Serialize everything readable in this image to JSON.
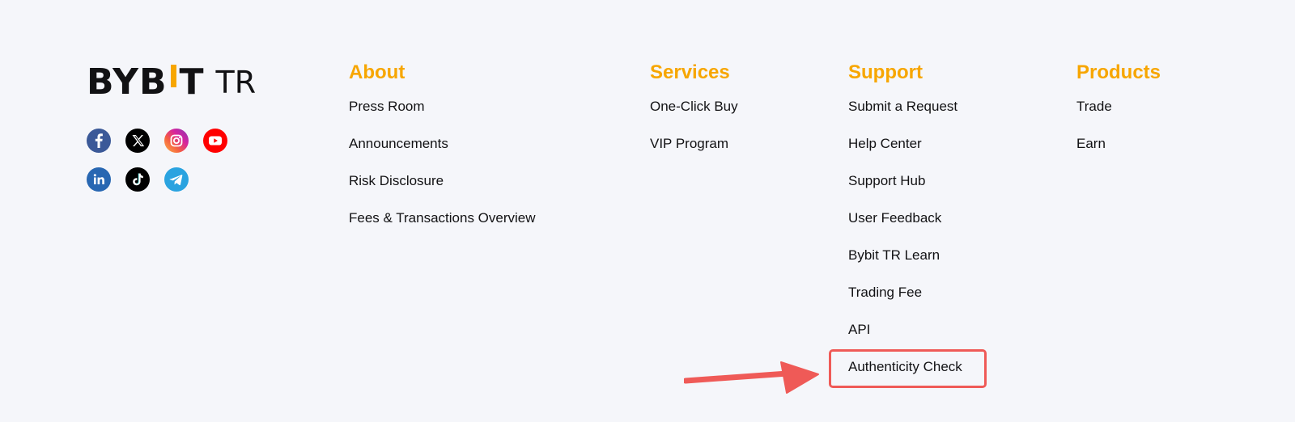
{
  "brand": {
    "logo_left": "BYB",
    "logo_right": "T",
    "logo_suffix": "TR",
    "accent_color": "#f7a600"
  },
  "social": [
    {
      "icon": "facebook-icon",
      "color": "#3b5998"
    },
    {
      "icon": "x-icon",
      "color": "#000000"
    },
    {
      "icon": "instagram-icon",
      "color": "#d6249f"
    },
    {
      "icon": "youtube-icon",
      "color": "#ff0000"
    },
    {
      "icon": "linkedin-icon",
      "color": "#2867b2"
    },
    {
      "icon": "tiktok-icon",
      "color": "#000000"
    },
    {
      "icon": "telegram-icon",
      "color": "#2aa3e0"
    }
  ],
  "columns": {
    "about": {
      "title": "About",
      "links": [
        "Press Room",
        "Announcements",
        "Risk Disclosure",
        "Fees & Transactions Overview"
      ]
    },
    "services": {
      "title": "Services",
      "links": [
        "One-Click Buy",
        "VIP Program"
      ]
    },
    "support": {
      "title": "Support",
      "links": [
        "Submit a Request",
        "Help Center",
        "Support Hub",
        "User Feedback",
        "Bybit TR Learn",
        "Trading Fee",
        "API",
        "Authenticity Check"
      ]
    },
    "products": {
      "title": "Products",
      "links": [
        "Trade",
        "Earn"
      ]
    }
  },
  "annotation": {
    "highlighted_item": "Authenticity Check",
    "color": "#ef5a57"
  }
}
